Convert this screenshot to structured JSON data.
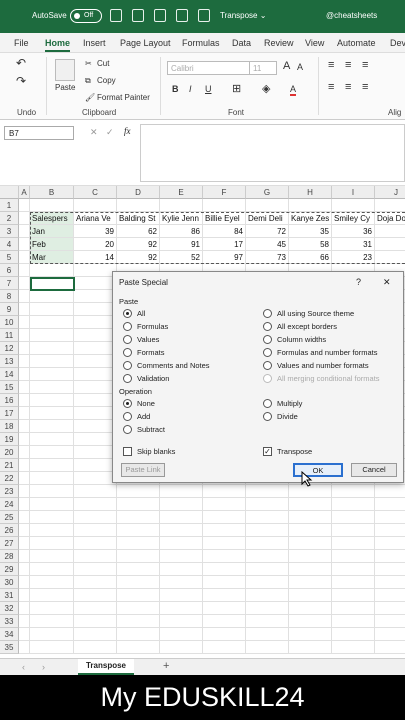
{
  "titlebar": {
    "autosave": "AutoSave",
    "toggle": "Off",
    "doc": "Transpose ⌄",
    "handle": "@cheatsheets"
  },
  "menu": [
    "File",
    "Home",
    "Insert",
    "Page Layout",
    "Formulas",
    "Data",
    "Review",
    "View",
    "Automate",
    "Deve"
  ],
  "ribbon": {
    "cut": "Cut",
    "copy": "Copy",
    "paste": "Paste",
    "format_painter": "Format Painter",
    "font_name": "Calibri",
    "font_size": "11",
    "bold": "B",
    "italic": "I",
    "underline": "U",
    "font_grow": "A",
    "font_shrink": "A",
    "groups": {
      "undo": "Undo",
      "clipboard": "Clipboard",
      "font": "Font",
      "alignment": "Alig"
    }
  },
  "namebox": "B7",
  "fx": "fx",
  "columns": [
    "A",
    "B",
    "C",
    "D",
    "E",
    "F",
    "G",
    "H",
    "I",
    "J"
  ],
  "rows": [
    "1",
    "2",
    "3",
    "4",
    "5",
    "6",
    "7",
    "8",
    "9",
    "10",
    "11",
    "12",
    "13",
    "14",
    "15",
    "16",
    "17",
    "18",
    "19",
    "20",
    "21",
    "22",
    "23",
    "24",
    "25",
    "26",
    "27",
    "28",
    "29",
    "30",
    "31",
    "32",
    "33",
    "34",
    "35"
  ],
  "table": {
    "header": [
      "Salespers",
      "Ariana Ve",
      "Balding St",
      "Kylie Jenn",
      "Billie Eyel",
      "Demi Deli",
      "Kanye Zes",
      "Smiley Cy",
      "Doja Do"
    ],
    "data": [
      [
        "Jan",
        "39",
        "62",
        "86",
        "84",
        "72",
        "35",
        "36",
        ""
      ],
      [
        "Feb",
        "20",
        "92",
        "91",
        "17",
        "45",
        "58",
        "31",
        ""
      ],
      [
        "Mar",
        "14",
        "92",
        "52",
        "97",
        "73",
        "66",
        "23",
        ""
      ]
    ]
  },
  "dialog": {
    "title": "Paste Special",
    "help": "?",
    "close": "✕",
    "paste_label": "Paste",
    "paste_left": [
      "All",
      "Formulas",
      "Values",
      "Formats",
      "Comments and Notes",
      "Validation"
    ],
    "paste_right": [
      "All using Source theme",
      "All except borders",
      "Column widths",
      "Formulas and number formats",
      "Values and number formats",
      "All merging conditional formats"
    ],
    "operation_label": "Operation",
    "op_left": [
      "None",
      "Add",
      "Subtract"
    ],
    "op_right": [
      "Multiply",
      "Divide"
    ],
    "skip_blanks": "Skip blanks",
    "transpose": "Transpose",
    "paste_link": "Paste Link",
    "ok": "OK",
    "cancel": "Cancel"
  },
  "sheet_tab": "Transpose",
  "add_sheet": "+",
  "caption": "My EDUSKILL24"
}
